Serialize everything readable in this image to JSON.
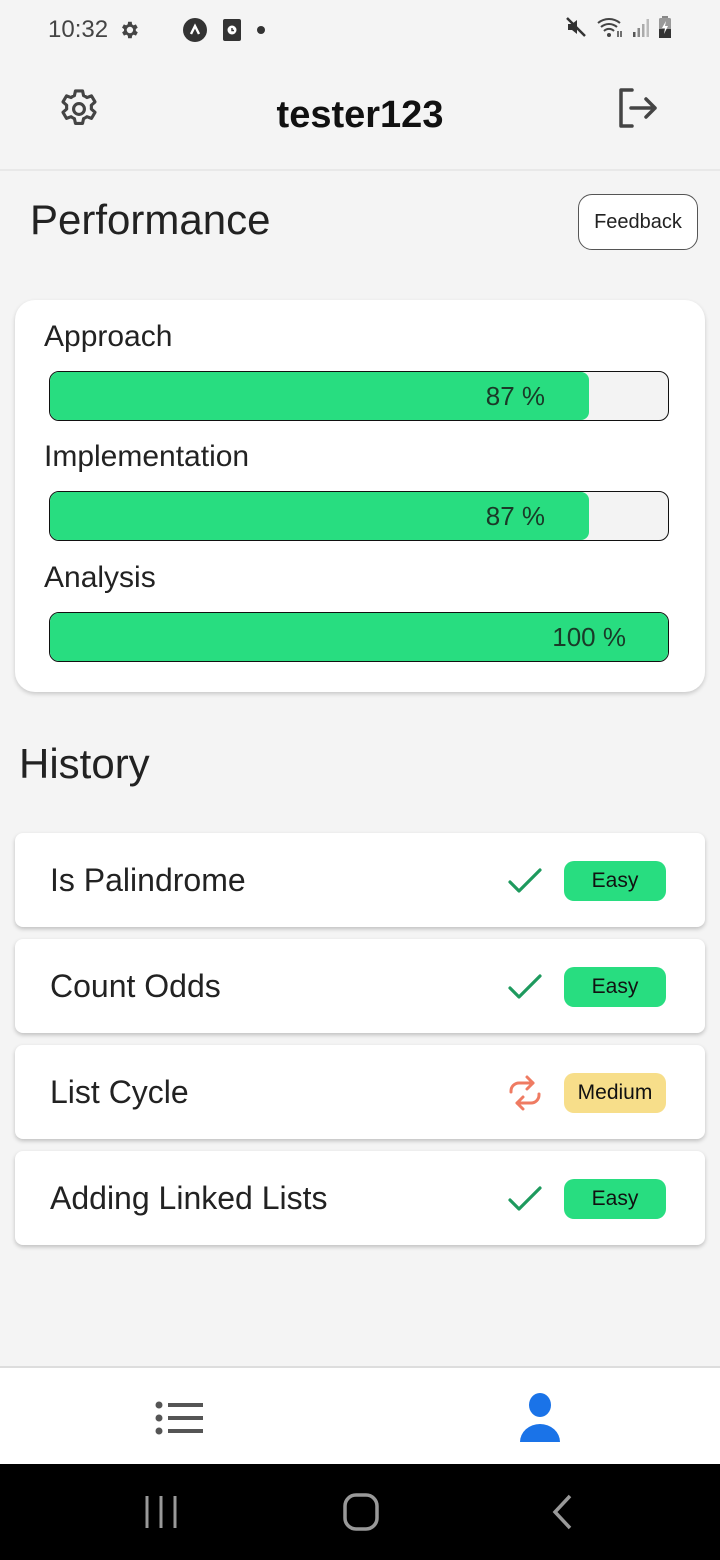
{
  "status_bar": {
    "time": "10:32",
    "left_icons": [
      "settings-icon",
      "app-a-icon",
      "clock-app-icon",
      "dot-icon"
    ],
    "right_icons": [
      "mute-icon",
      "wifi-icon",
      "signal-icon",
      "battery-charging-icon"
    ]
  },
  "header": {
    "username": "tester123",
    "left_icon": "gear-icon",
    "right_icon": "logout-icon"
  },
  "performance": {
    "title": "Performance",
    "feedback_label": "Feedback",
    "colors": {
      "fill": "#28dd80",
      "track": "#f3f3f3"
    },
    "metrics": [
      {
        "label": "Approach",
        "value": 87,
        "display": "87 %"
      },
      {
        "label": "Implementation",
        "value": 87,
        "display": "87 %"
      },
      {
        "label": "Analysis",
        "value": 100,
        "display": "100 %"
      }
    ]
  },
  "history": {
    "title": "History",
    "items": [
      {
        "name": "Is Palindrome",
        "status": "completed",
        "status_icon": "check-icon",
        "difficulty": "Easy",
        "badge_color": "#28dd80"
      },
      {
        "name": "Count Odds",
        "status": "completed",
        "status_icon": "check-icon",
        "difficulty": "Easy",
        "badge_color": "#28dd80"
      },
      {
        "name": "List Cycle",
        "status": "in-progress",
        "status_icon": "retry-icon",
        "difficulty": "Medium",
        "badge_color": "#f7de8a"
      },
      {
        "name": "Adding Linked Lists",
        "status": "completed",
        "status_icon": "check-icon",
        "difficulty": "Easy",
        "badge_color": "#28dd80"
      }
    ]
  },
  "bottom_nav": {
    "items": [
      {
        "name": "problems-list",
        "icon": "list-icon",
        "active": false
      },
      {
        "name": "profile",
        "icon": "person-icon",
        "active": true
      }
    ],
    "active_color": "#1a73e8",
    "inactive_color": "#555555"
  },
  "system_nav": {
    "buttons": [
      "recent-apps",
      "home",
      "back"
    ]
  }
}
